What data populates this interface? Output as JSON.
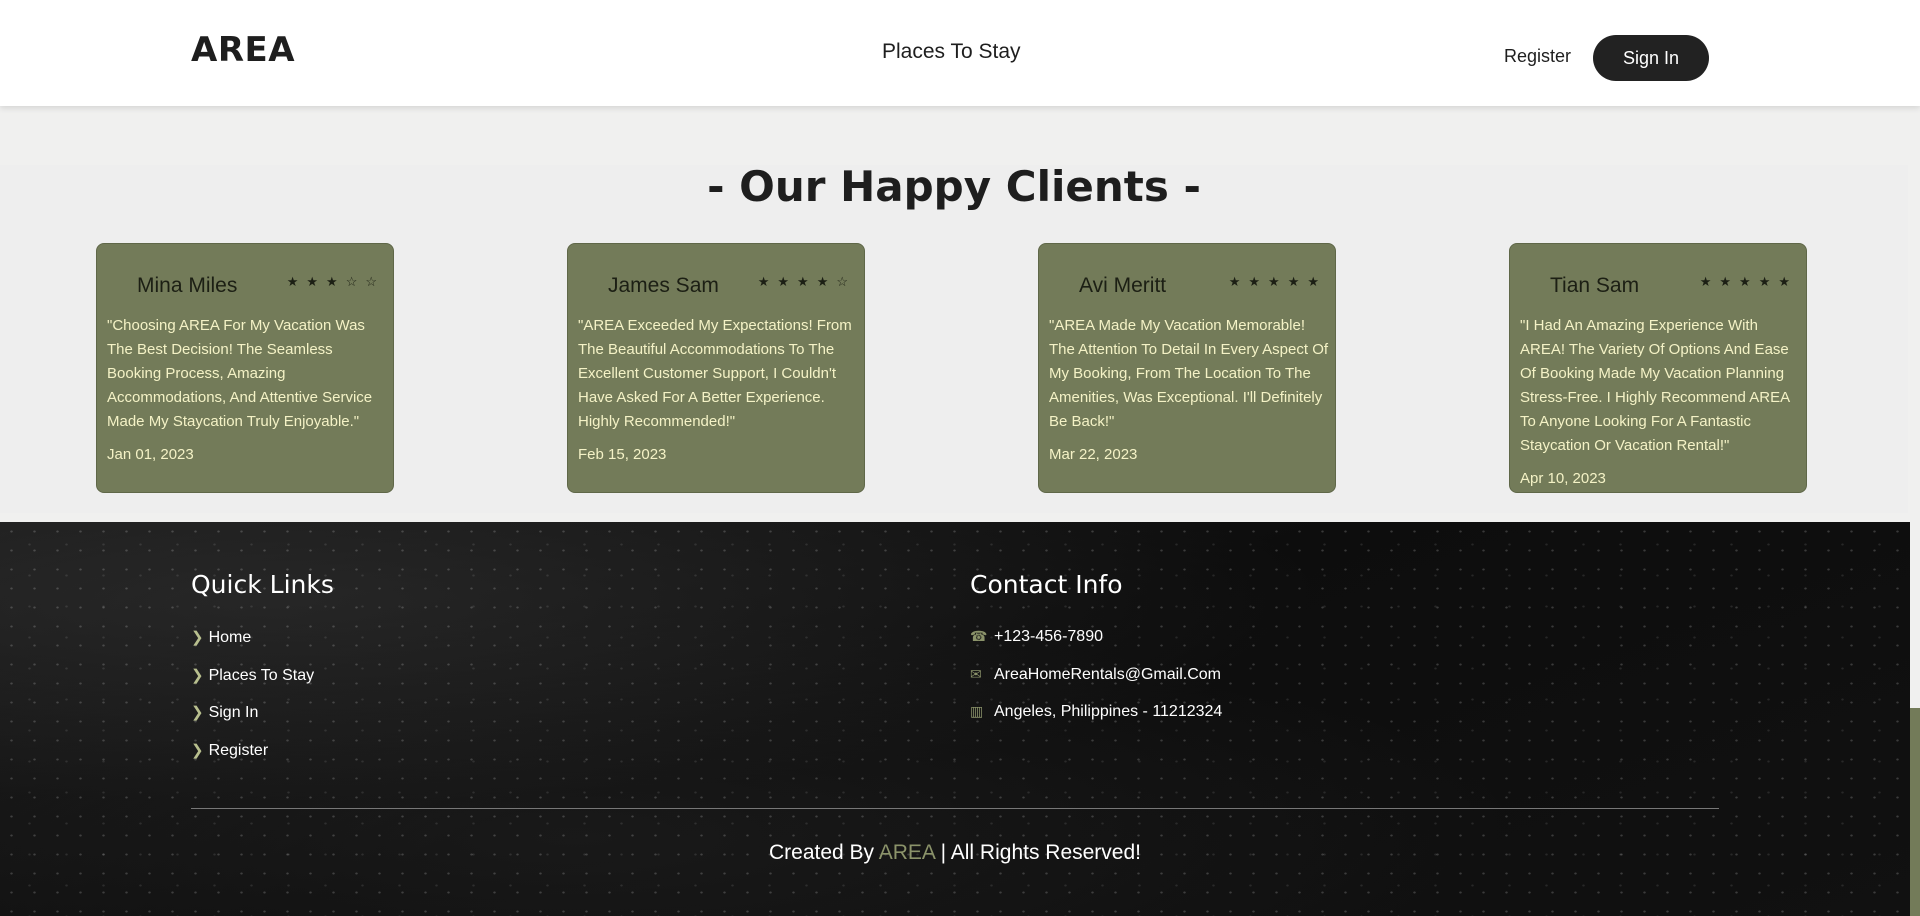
{
  "header": {
    "logo": "AREA",
    "nav_places": "Places To Stay",
    "register": "Register",
    "sign_in": "Sign In"
  },
  "clients": {
    "title": "- Our Happy Clients -",
    "cards": [
      {
        "name": "Mina Miles",
        "rating": 3,
        "text": "\"Choosing AREA For My Vacation Was The Best Decision! The Seamless Booking Process, Amazing Accommodations, And Attentive Service Made My Staycation Truly Enjoyable.\"",
        "date": "Jan 01, 2023"
      },
      {
        "name": "James Sam",
        "rating": 4,
        "text": "\"AREA Exceeded My Expectations! From The Beautiful Accommodations To The Excellent Customer Support, I Couldn't Have Asked For A Better Experience. Highly Recommended!\"",
        "date": "Feb 15, 2023"
      },
      {
        "name": "Avi Meritt",
        "rating": 5,
        "text": "\"AREA Made My Vacation Memorable! The Attention To Detail In Every Aspect Of My Booking, From The Location To The Amenities, Was Exceptional. I'll Definitely Be Back!\"",
        "date": "Mar 22, 2023"
      },
      {
        "name": "Tian Sam",
        "rating": 5,
        "text": "\"I Had An Amazing Experience With AREA! The Variety Of Options And Ease Of Booking Made My Vacation Planning Stress-Free. I Highly Recommend AREA To Anyone Looking For A Fantastic Staycation Or Vacation Rental!\"",
        "date": "Apr 10, 2023"
      }
    ]
  },
  "footer": {
    "quick_links_title": "Quick Links",
    "quick_links": [
      "Home",
      "Places To Stay",
      "Sign In",
      "Register"
    ],
    "contact_title": "Contact Info",
    "phone": "+123-456-7890",
    "email": "AreaHomeRentals@Gmail.Com",
    "address": "Angeles, Philippines - 11212324",
    "copyright_prefix": "Created By",
    "copyright_brand": "AREA",
    "copyright_suffix": "| All Rights Reserved!"
  },
  "icons": {
    "phone": "phone-icon",
    "email": "envelope-icon",
    "address": "map-icon",
    "link_bullet": "chevron-right-icon",
    "star_filled": "star-filled-icon",
    "star_empty": "star-outline-icon"
  },
  "colors": {
    "card_bg": "#737b59",
    "accent": "#8b936a",
    "header_button": "#222222"
  }
}
